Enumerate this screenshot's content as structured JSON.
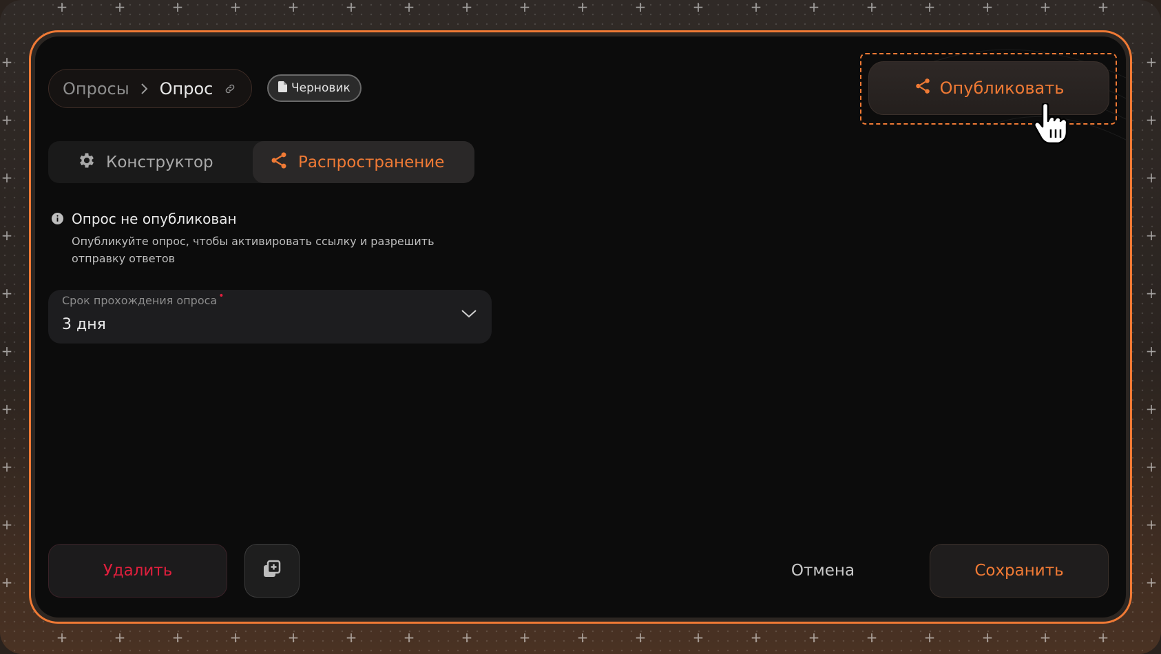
{
  "breadcrumb": {
    "parent": "Опросы",
    "current": "Опрос"
  },
  "status_badge": {
    "label": "Черновик"
  },
  "publish_button": {
    "label": "Опубликовать"
  },
  "tabs": [
    {
      "label": "Конструктор",
      "icon": "gear-icon",
      "active": false
    },
    {
      "label": "Распространение",
      "icon": "share-icon",
      "active": true
    }
  ],
  "notice": {
    "title": "Опрос не опубликован",
    "text": "Опубликуйте опрос, чтобы активировать ссылку и разрешить отправку ответов"
  },
  "deadline_field": {
    "label": "Срок прохождения опроса",
    "required_mark": "•",
    "value": "3 дня"
  },
  "footer": {
    "delete_label": "Удалить",
    "cancel_label": "Отмена",
    "save_label": "Сохранить"
  },
  "colors": {
    "accent": "#f07a35",
    "danger": "#e01f3d",
    "panel": "#0c0c0c"
  }
}
